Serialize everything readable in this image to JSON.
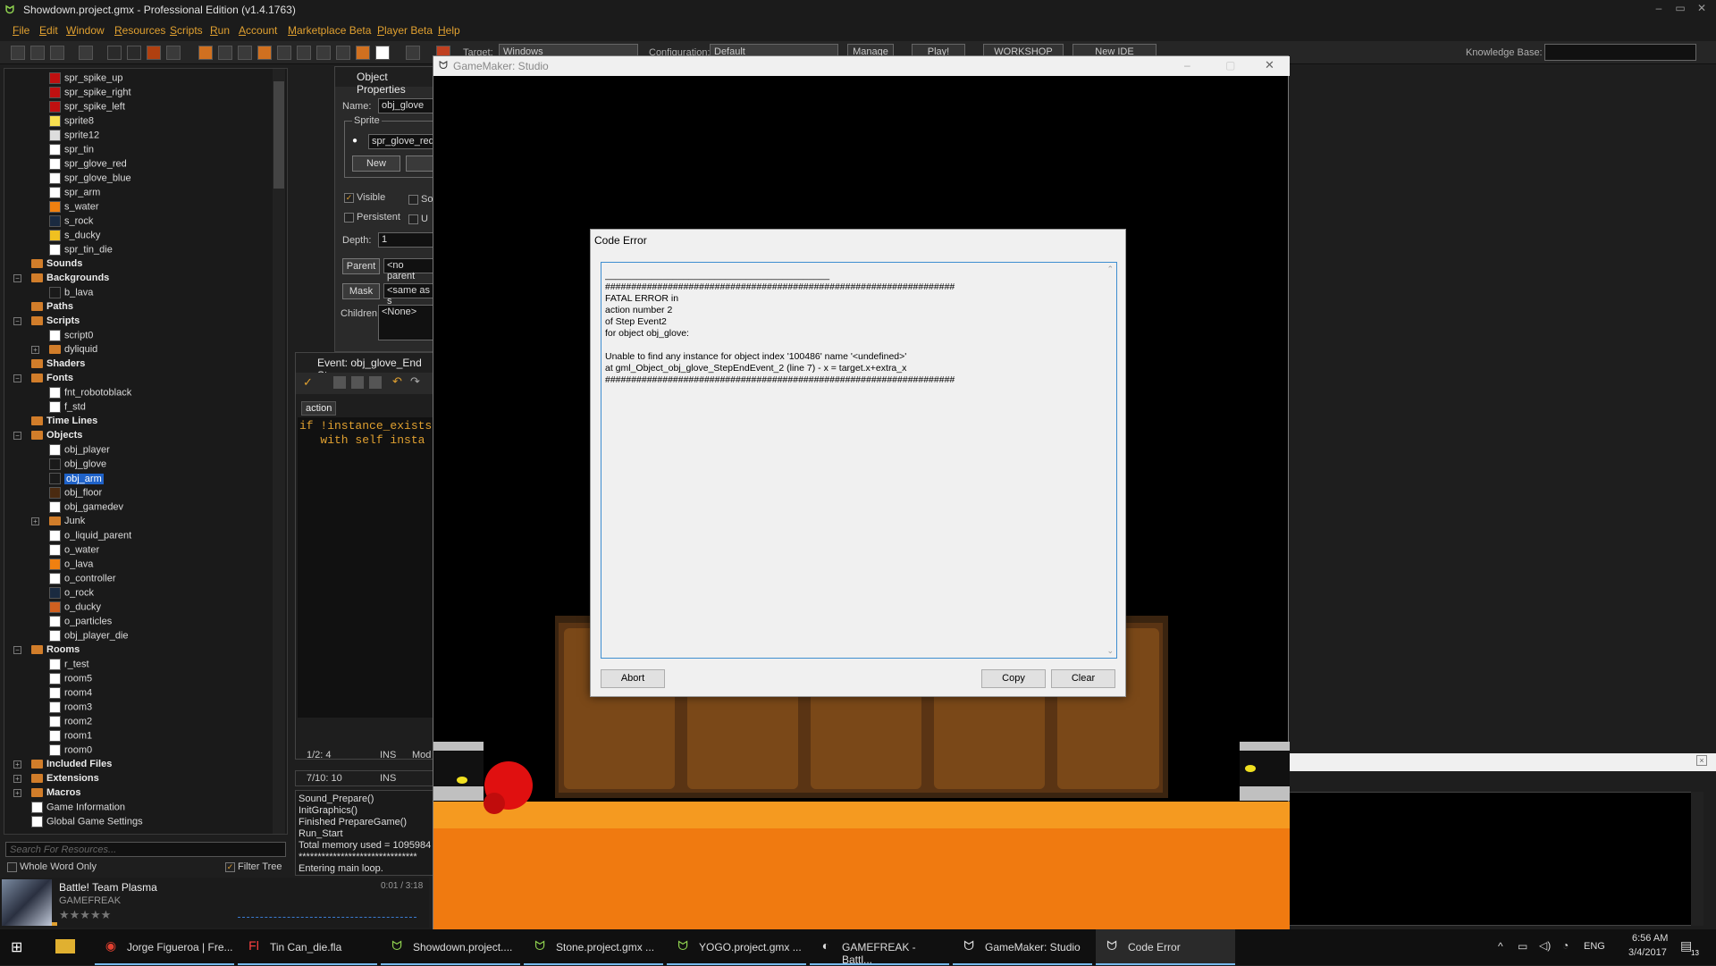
{
  "window": {
    "title": "Showdown.project.gmx  -  Professional Edition (v1.4.1763)",
    "logo": "gamemaker-icon"
  },
  "menu": [
    "File",
    "Edit",
    "Window",
    "Resources",
    "Scripts",
    "Run",
    "Account",
    "Marketplace Beta",
    "Player Beta",
    "Help"
  ],
  "toolbar": {
    "target_label": "Target:",
    "target_value": "Windows",
    "config_label": "Configuration:",
    "config_value": "Default",
    "manage": "Manage",
    "play": "Play!",
    "workshop": "WORKSHOP",
    "new_ide": "New IDE",
    "kb_label": "Knowledge Base:"
  },
  "tree": {
    "sprites": [
      "spr_spike_up",
      "spr_spike_right",
      "spr_spike_left",
      "sprite8",
      "sprite12",
      "spr_tin",
      "spr_glove_red",
      "spr_glove_blue",
      "spr_arm",
      "s_water",
      "s_rock",
      "s_ducky",
      "spr_tin_die"
    ],
    "sounds": "Sounds",
    "backgrounds": "Backgrounds",
    "backgrounds_items": [
      "b_lava"
    ],
    "paths": "Paths",
    "scripts": "Scripts",
    "scripts_items": [
      "script0",
      "dyliquid"
    ],
    "shaders": "Shaders",
    "fonts": "Fonts",
    "fonts_items": [
      "fnt_robotoblack",
      "f_std"
    ],
    "timelines": "Time Lines",
    "objects": "Objects",
    "objects_items": [
      "obj_player",
      "obj_glove",
      "obj_arm",
      "obj_floor",
      "obj_gamedev",
      "Junk",
      "o_liquid_parent",
      "o_water",
      "o_lava",
      "o_controller",
      "o_rock",
      "o_ducky",
      "o_particles",
      "obj_player_die"
    ],
    "rooms": "Rooms",
    "rooms_items": [
      "r_test",
      "room5",
      "room4",
      "room3",
      "room2",
      "room1",
      "room0"
    ],
    "included": "Included Files",
    "extensions": "Extensions",
    "macros": "Macros",
    "game_info": "Game Information",
    "global_settings": "Global Game Settings",
    "search_placeholder": "Search For Resources...",
    "whole_word": "Whole Word Only",
    "filter_tree": "Filter Tree"
  },
  "music": {
    "title": "Battle! Team Plasma",
    "artist": "GAMEFREAK",
    "time": "0:01 / 3:18"
  },
  "object_props": {
    "title": "Object Properties",
    "name_label": "Name:",
    "name_value": "obj_glove",
    "sprite_group": "Sprite",
    "sprite_value": "spr_glove_red",
    "new_btn": "New",
    "visible": "Visible",
    "solid_trunc": "So",
    "persistent": "Persistent",
    "uses_trunc": "U",
    "depth_label": "Depth:",
    "depth_value": "1",
    "parent_btn": "Parent",
    "parent_value": "<no parent",
    "mask_btn": "Mask",
    "mask_value": "<same as s",
    "children_label": "Children:",
    "children_value": "<None>"
  },
  "event_editor": {
    "title": "Event: obj_glove_End Ste",
    "tab": "action",
    "code_line1": "if !instance_exists",
    "code_line2": "   with self insta",
    "status1_pos": "1/2:  4",
    "status1_mode": "INS",
    "status1_extra": "Mod",
    "status2_pos": "7/10:  10",
    "status2_mode": "INS"
  },
  "output": [
    "Sound_Prepare()",
    "InitGraphics()",
    "Finished PrepareGame()",
    "Run_Start",
    "Total memory used = 1095984",
    "*******************************",
    "Entering main loop."
  ],
  "game_window": {
    "title": "GameMaker: Studio"
  },
  "dialog": {
    "title": "Code Error",
    "lines": [
      "___________________________________________",
      "###################################################################",
      "FATAL ERROR in",
      "action number 2",
      "of  Step Event2",
      "for object obj_glove:",
      "",
      "Unable to find any instance for object index '100486' name '<undefined>'",
      " at gml_Object_obj_glove_StepEndEvent_2 (line 7) - x = target.x+extra_x",
      "###################################################################"
    ],
    "abort": "Abort",
    "copy": "Copy",
    "clear": "Clear"
  },
  "taskbar": {
    "items": [
      "Jorge Figueroa | Fre...",
      "Tin Can_die.fla",
      "Showdown.project....",
      "Stone.project.gmx ...",
      "YOGO.project.gmx ...",
      "GAMEFREAK - Battl...",
      "GameMaker: Studio",
      "Code Error"
    ],
    "lang": "ENG",
    "time": "6:56 AM",
    "date": "3/4/2017",
    "notif_count": "13"
  },
  "colors": {
    "menu_text": "#e0a030",
    "selection": "#1f62c8",
    "folder": "#d17d2a",
    "lava": "#f07a10",
    "glove": "#e01010"
  }
}
